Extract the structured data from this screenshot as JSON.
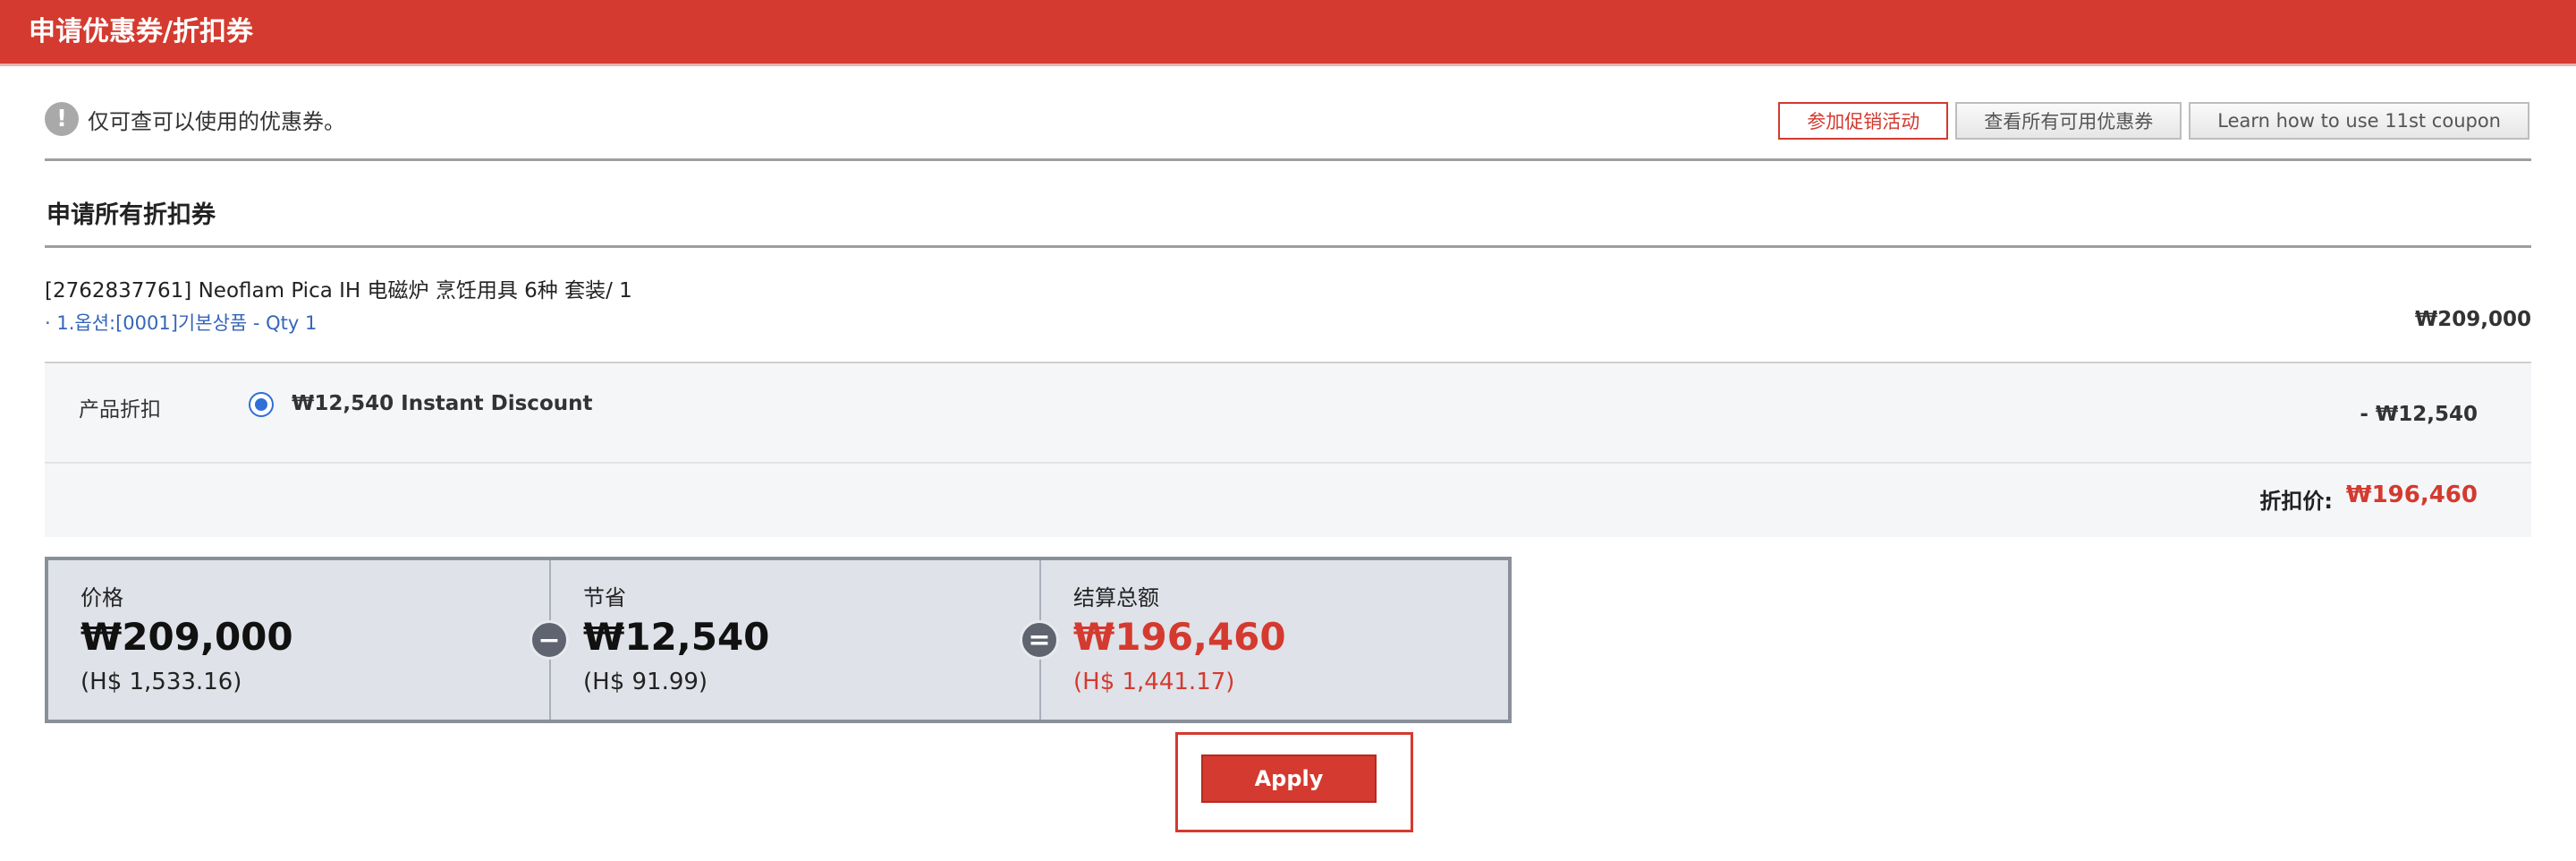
{
  "header": {
    "title": "申请优惠券/折扣券"
  },
  "notice": {
    "icon": "exclamation-icon",
    "text": "仅可查可以使用的优惠券。"
  },
  "top_buttons": {
    "promo": "参加促销活动",
    "all_coupons": "查看所有可用优惠券",
    "learn": "Learn how to use 11st coupon"
  },
  "section": {
    "title": "申请所有折扣券"
  },
  "product": {
    "name": "[2762837761] Neoflam Pica IH 电磁炉 烹饪用具 6种 套装/ 1",
    "option": "· 1.옵션:[0001]기본상품 - Qty 1",
    "price": "₩209,000"
  },
  "discount": {
    "label": "产品折扣",
    "option_name": "₩12,540 Instant Discount",
    "amount": "- ₩12,540",
    "final_label": "折扣价:",
    "final_value": "₩196,460"
  },
  "summary": {
    "price_label": "价格",
    "price_value": "₩209,000",
    "price_sub": "(H$ 1,533.16)",
    "minus_symbol": "−",
    "save_label": "节省",
    "save_value": "₩12,540",
    "save_sub": "(H$ 91.99)",
    "equals_symbol": "=",
    "total_label": "结算总额",
    "total_value": "₩196,460",
    "total_sub": "(H$ 1,441.17)"
  },
  "apply": {
    "label": "Apply"
  },
  "colors": {
    "brand_red": "#d43a2f",
    "link_blue": "#3565b8",
    "radio_blue": "#2f6fd8"
  }
}
